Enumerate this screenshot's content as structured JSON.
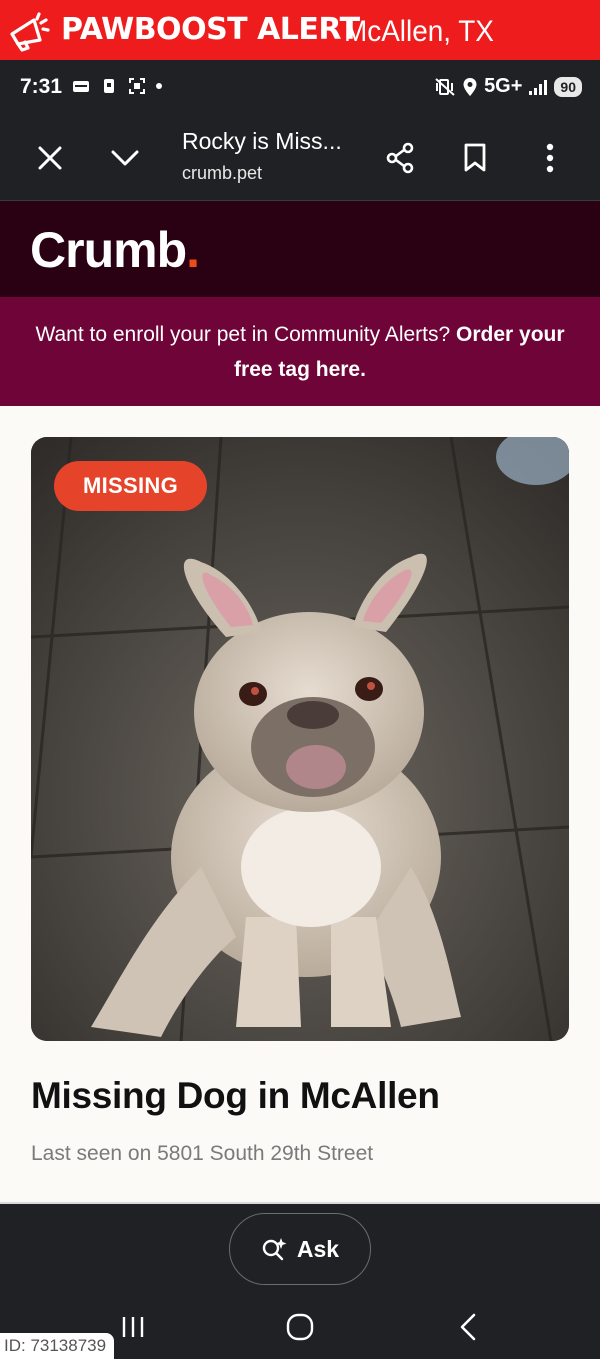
{
  "banner": {
    "title": "PAWBOOST ALERT",
    "location": "McAllen, TX",
    "icon": "megaphone-icon",
    "color": "#ee1c1c"
  },
  "status_bar": {
    "time": "7:31",
    "network": "5G+",
    "battery": "90"
  },
  "browser": {
    "tab_title": "Rocky is Miss...",
    "url": "crumb.pet"
  },
  "site": {
    "logo": "Crumb",
    "logo_dot": ".",
    "header_color": "#2a0013",
    "accent": "#ef4c1c"
  },
  "enroll_banner": {
    "text": "Want to enroll your pet in Community Alerts? ",
    "link_text": "Order your free tag here.",
    "color": "#6e0438"
  },
  "pet": {
    "status_badge": "MISSING",
    "badge_color": "#e6432b",
    "headline": "Missing Dog in McAllen",
    "last_seen": "Last seen on 5801 South 29th Street"
  },
  "assistant": {
    "ask_label": "Ask"
  },
  "footer": {
    "id_label": "ID: 73138739"
  }
}
